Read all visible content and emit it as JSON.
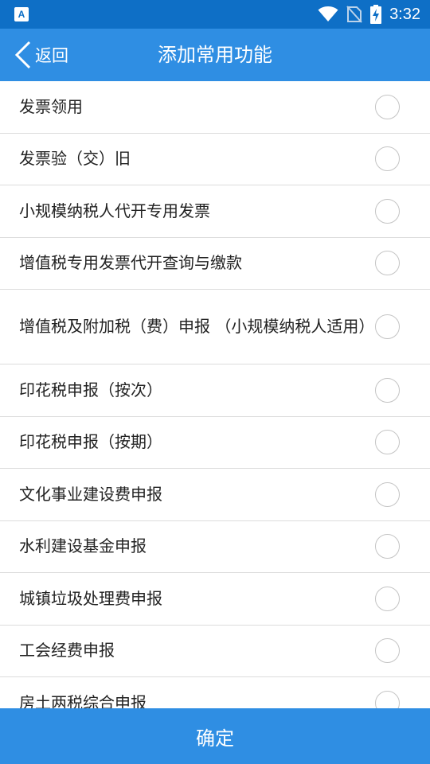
{
  "status_bar": {
    "notif_icon_letter": "A",
    "time": "3:32",
    "icons": [
      "wifi-icon",
      "no-sim-icon",
      "battery-charging-icon"
    ]
  },
  "header": {
    "back_label": "返回",
    "title": "添加常用功能"
  },
  "items": [
    {
      "label": "发票领用",
      "checked": false
    },
    {
      "label": "发票验（交）旧",
      "checked": false
    },
    {
      "label": "小规模纳税人代开专用发票",
      "checked": false
    },
    {
      "label": "增值税专用发票代开查询与缴款",
      "checked": false
    },
    {
      "label": "增值税及附加税（费）申报 （小规模纳税人适用）",
      "checked": false
    },
    {
      "label": "印花税申报（按次）",
      "checked": false
    },
    {
      "label": "印花税申报（按期）",
      "checked": false
    },
    {
      "label": "文化事业建设费申报",
      "checked": false
    },
    {
      "label": "水利建设基金申报",
      "checked": false
    },
    {
      "label": "城镇垃圾处理费申报",
      "checked": false
    },
    {
      "label": "工会经费申报",
      "checked": false
    },
    {
      "label": "房土两税综合申报",
      "checked": false
    }
  ],
  "footer": {
    "confirm_label": "确定"
  },
  "colors": {
    "status_bar": "#0e6fc6",
    "app_bar": "#2f8ee3",
    "confirm_bar": "#2f8ee3"
  }
}
